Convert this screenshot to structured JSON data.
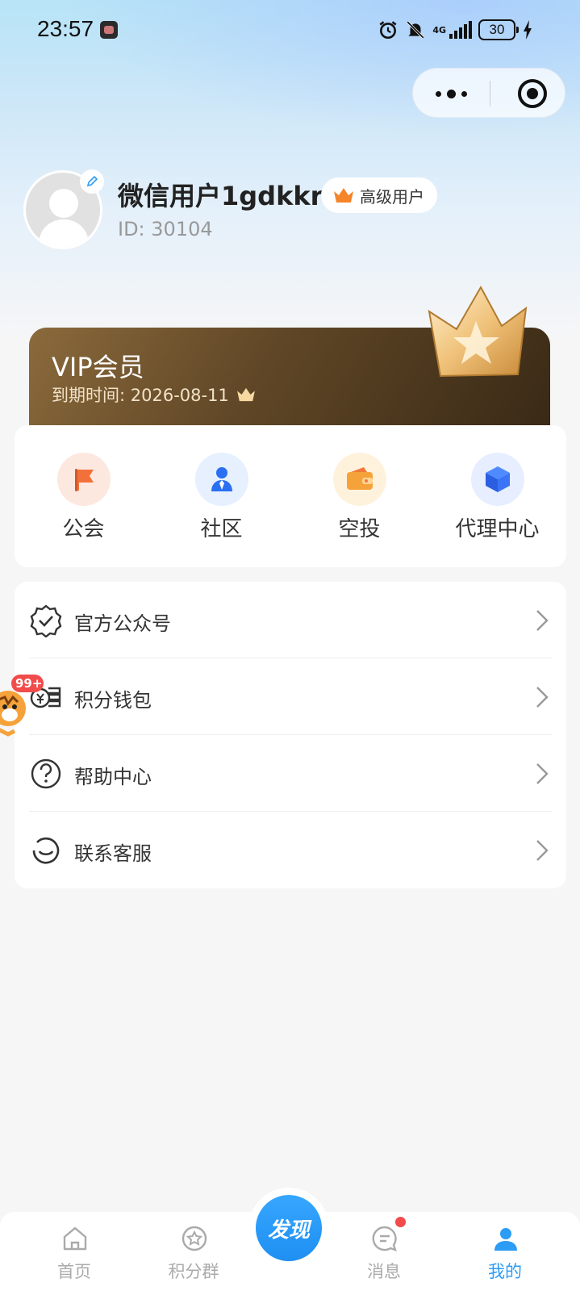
{
  "status_bar": {
    "time": "23:57",
    "network": "4G",
    "battery": "30"
  },
  "capsule": {
    "more_icon": "more-dots-icon",
    "close_icon": "target-close-icon"
  },
  "profile": {
    "name": "微信用户1gdkkr",
    "level_badge": "高级用户",
    "id_text": "ID: 30104"
  },
  "vip": {
    "title": "VIP会员",
    "expire": "到期时间: 2026-08-11"
  },
  "quick_actions": [
    {
      "label": "公会",
      "icon": "flag-icon",
      "bg": "#fde8e0"
    },
    {
      "label": "社区",
      "icon": "person-tie-icon",
      "bg": "#e6f0ff"
    },
    {
      "label": "空投",
      "icon": "wallet-icon",
      "bg": "#fff2dd"
    },
    {
      "label": "代理中心",
      "icon": "cube-icon",
      "bg": "#e6eeff"
    }
  ],
  "menu": [
    {
      "label": "官方公众号",
      "icon": "verified-badge-icon"
    },
    {
      "label": "积分钱包",
      "icon": "coin-stack-icon"
    },
    {
      "label": "帮助中心",
      "icon": "help-circle-icon"
    },
    {
      "label": "联系客服",
      "icon": "smile-service-icon"
    }
  ],
  "float_widget": {
    "badge": "99+"
  },
  "tabbar": {
    "home": "首页",
    "group": "积分群",
    "discover": "发现",
    "messages": "消息",
    "mine": "我的"
  },
  "colors": {
    "accent": "#2d9cf5",
    "vip_dark": "#3a2a16",
    "vip_light": "#8b6a3c"
  }
}
